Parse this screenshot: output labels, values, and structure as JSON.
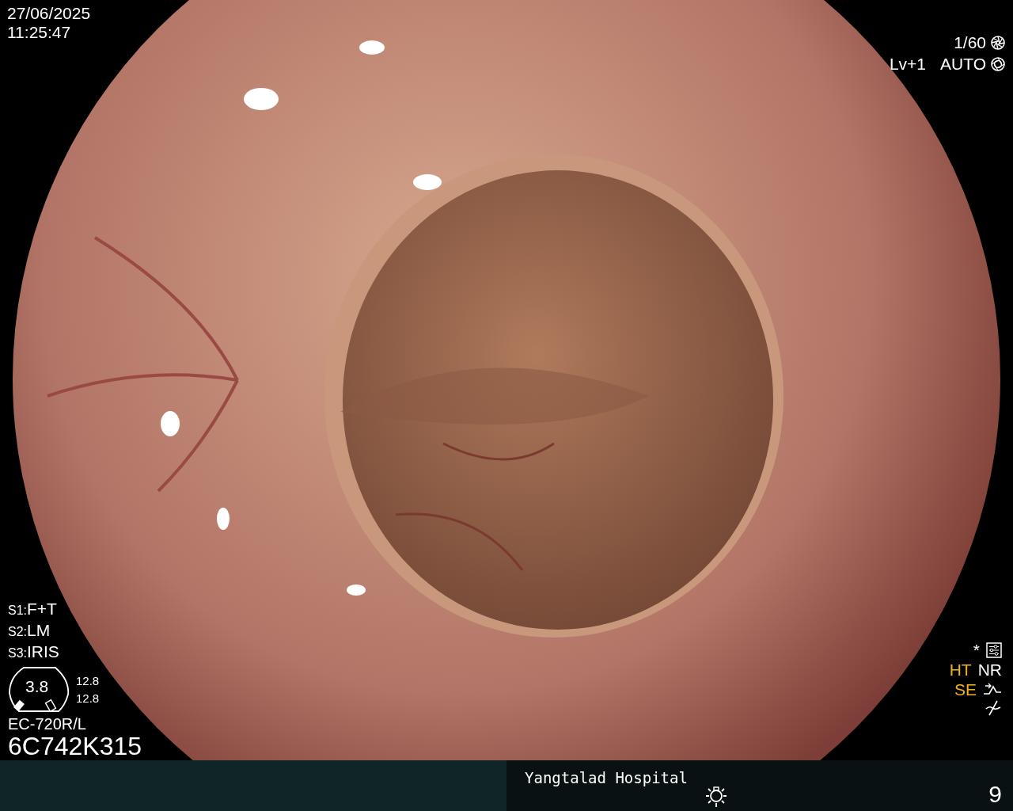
{
  "datetime": {
    "date": "27/06/2025",
    "time": "11:25:47"
  },
  "exposure": {
    "shutter": "1/60",
    "brightness_level": "Lv+1",
    "iris_mode": "AUTO"
  },
  "switches": [
    {
      "label": "S1:",
      "value": "F+T"
    },
    {
      "label": "S2:",
      "value": "LM"
    },
    {
      "label": "S3:",
      "value": "IRIS"
    }
  ],
  "scope_gauge": {
    "value": "3.8",
    "readings": [
      "12.8",
      "12.8"
    ]
  },
  "scope_model": "EC-720R/L",
  "serial": "6C742K315",
  "enhancement": {
    "mark": "*",
    "mode_rows": [
      [
        {
          "label": "HT",
          "active": true
        },
        {
          "label": "NR",
          "active": false
        }
      ],
      [
        {
          "label": "SE",
          "active": true
        }
      ]
    ]
  },
  "footer": {
    "hospital": "Yangtalad Hospital",
    "page": "9"
  }
}
